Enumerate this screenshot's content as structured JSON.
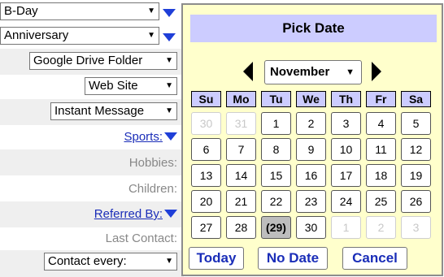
{
  "form": {
    "bday_select": "B-Day",
    "anniversary_select": "Anniversary",
    "gdrive_select": "Google Drive Folder",
    "website_select": "Web Site",
    "im_select": "Instant Message",
    "sports_link": "Sports:",
    "hobbies_label": "Hobbies:",
    "children_label": "Children:",
    "referred_link": "Referred By:",
    "last_contact_label": "Last Contact:",
    "contact_every_select": "Contact every:"
  },
  "calendar": {
    "title": "Pick Date",
    "month": "November",
    "weekdays": [
      "Su",
      "Mo",
      "Tu",
      "We",
      "Th",
      "Fr",
      "Sa"
    ],
    "weeks": [
      [
        {
          "d": "30",
          "other": true
        },
        {
          "d": "31",
          "other": true
        },
        {
          "d": "1"
        },
        {
          "d": "2"
        },
        {
          "d": "3"
        },
        {
          "d": "4"
        },
        {
          "d": "5"
        }
      ],
      [
        {
          "d": "6"
        },
        {
          "d": "7"
        },
        {
          "d": "8"
        },
        {
          "d": "9"
        },
        {
          "d": "10"
        },
        {
          "d": "11"
        },
        {
          "d": "12"
        }
      ],
      [
        {
          "d": "13"
        },
        {
          "d": "14"
        },
        {
          "d": "15"
        },
        {
          "d": "16"
        },
        {
          "d": "17"
        },
        {
          "d": "18"
        },
        {
          "d": "19"
        }
      ],
      [
        {
          "d": "20"
        },
        {
          "d": "21"
        },
        {
          "d": "22"
        },
        {
          "d": "23"
        },
        {
          "d": "24"
        },
        {
          "d": "25"
        },
        {
          "d": "26"
        }
      ],
      [
        {
          "d": "27"
        },
        {
          "d": "28"
        },
        {
          "d": "(29)",
          "today": true
        },
        {
          "d": "30"
        },
        {
          "d": "1",
          "other": true
        },
        {
          "d": "2",
          "other": true
        },
        {
          "d": "3",
          "other": true
        }
      ]
    ],
    "today_button": "Today",
    "nodate_button": "No Date",
    "cancel_button": "Cancel"
  }
}
